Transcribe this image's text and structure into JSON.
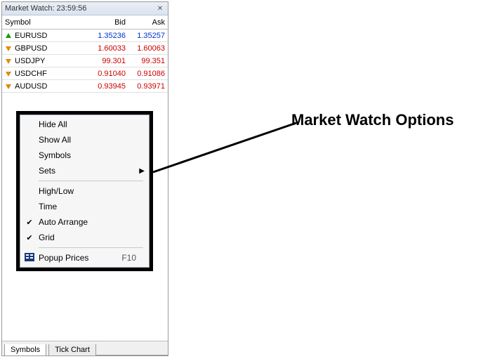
{
  "panel": {
    "title": "Market Watch: 23:59:56",
    "headers": {
      "symbol": "Symbol",
      "bid": "Bid",
      "ask": "Ask"
    },
    "rows": [
      {
        "symbol": "EURUSD",
        "bid": "1.35236",
        "ask": "1.35257",
        "dir": "up"
      },
      {
        "symbol": "GBPUSD",
        "bid": "1.60033",
        "ask": "1.60063",
        "dir": "down"
      },
      {
        "symbol": "USDJPY",
        "bid": "99.301",
        "ask": "99.351",
        "dir": "down"
      },
      {
        "symbol": "USDCHF",
        "bid": "0.91040",
        "ask": "0.91086",
        "dir": "down"
      },
      {
        "symbol": "AUDUSD",
        "bid": "0.93945",
        "ask": "0.93971",
        "dir": "down"
      }
    ]
  },
  "context_menu": {
    "items": [
      {
        "label": "Hide All",
        "checked": false,
        "submenu": false
      },
      {
        "label": "Show All",
        "checked": false,
        "submenu": false
      },
      {
        "label": "Symbols",
        "checked": false,
        "submenu": false
      },
      {
        "label": "Sets",
        "checked": false,
        "submenu": true
      },
      {
        "sep": true
      },
      {
        "label": "High/Low",
        "checked": false,
        "submenu": false
      },
      {
        "label": "Time",
        "checked": false,
        "submenu": false
      },
      {
        "label": "Auto Arrange",
        "checked": true,
        "submenu": false
      },
      {
        "label": "Grid",
        "checked": true,
        "submenu": false
      },
      {
        "sep": true
      },
      {
        "label": "Popup Prices",
        "checked": false,
        "submenu": false,
        "shortcut": "F10",
        "icon": "popup-icon"
      }
    ]
  },
  "tabs": {
    "items": [
      {
        "label": "Symbols",
        "active": true
      },
      {
        "label": "Tick Chart",
        "active": false
      }
    ]
  },
  "annotation": {
    "label": "Market Watch Options"
  }
}
